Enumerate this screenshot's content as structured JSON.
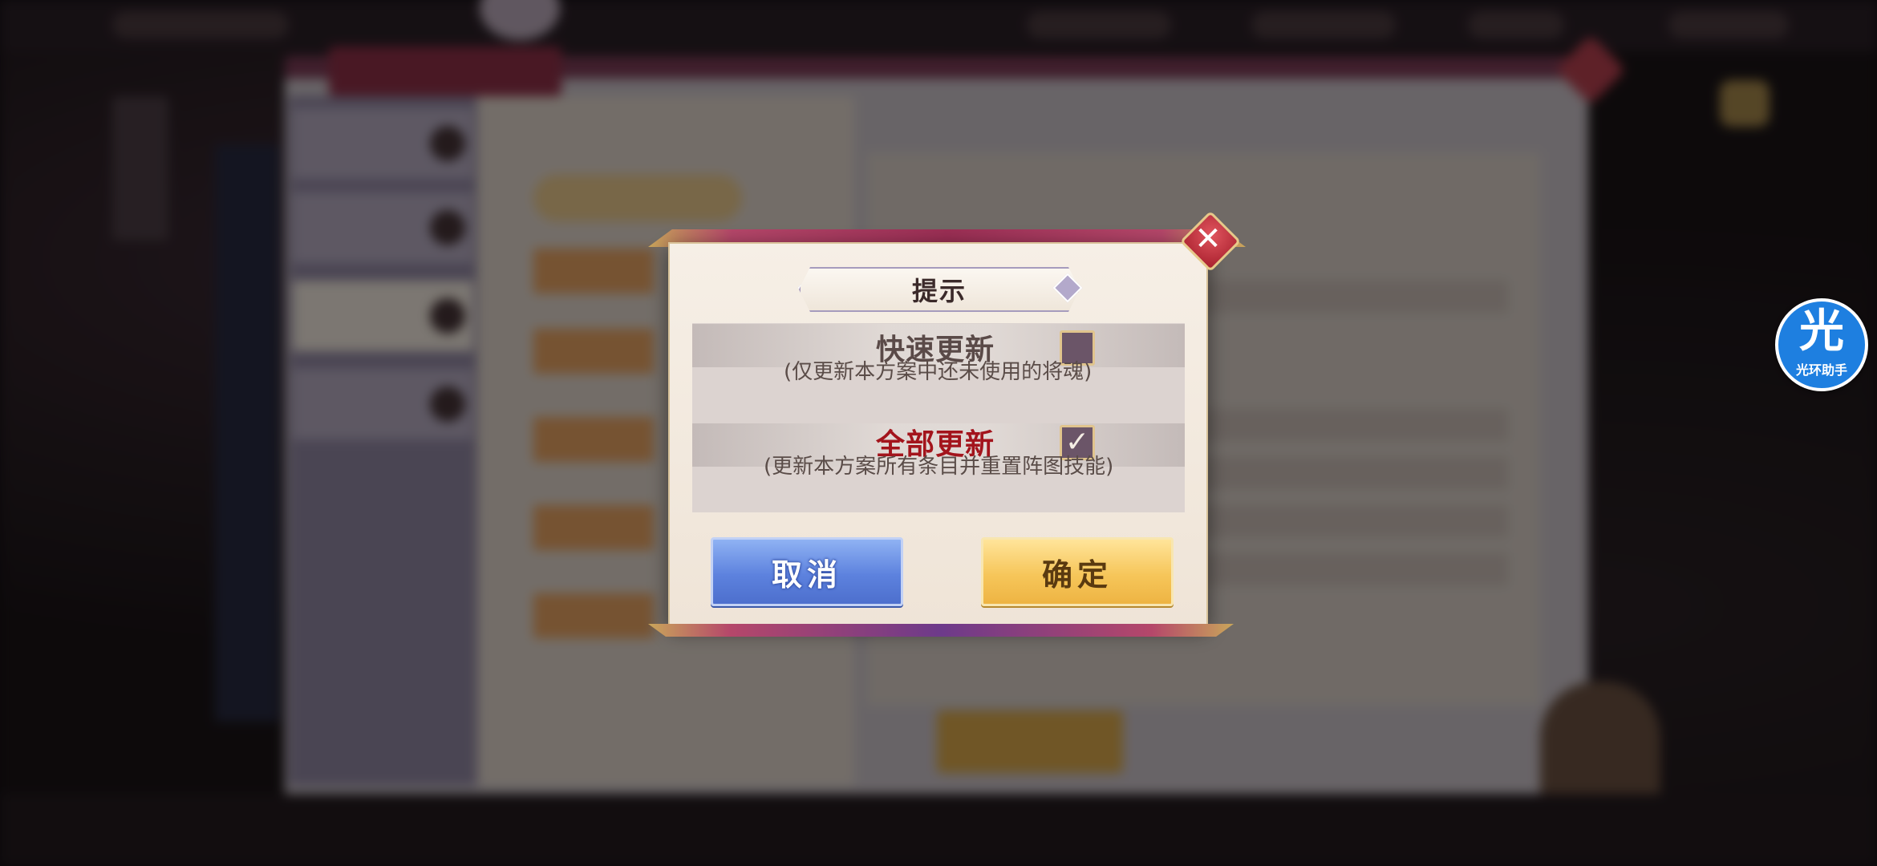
{
  "dialog": {
    "title": "提示",
    "options": [
      {
        "label": "快速更新",
        "description": "(仅更新本方案中还未使用的将魂)",
        "checked": false,
        "label_color": "#5a4a48"
      },
      {
        "label": "全部更新",
        "description": "(更新本方案所有条目并重置阵图技能)",
        "checked": true,
        "label_color": "#a3141c"
      }
    ],
    "check_mark": "✓",
    "close_glyph": "✕",
    "cancel_label": "取消",
    "confirm_label": "确定"
  },
  "assistant": {
    "glyph": "光",
    "name": "光环助手"
  },
  "colors": {
    "accent_red": "#a3141c",
    "cancel_blue": "#5d82de",
    "confirm_gold": "#f6c65a",
    "frame_purple": "#9c2f55"
  }
}
